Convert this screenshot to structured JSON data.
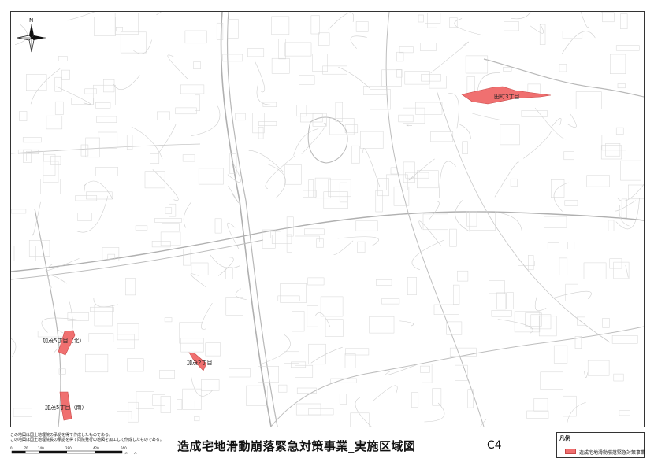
{
  "map": {
    "north_label": "N",
    "area_color": "#f07070",
    "area_stroke": "#c84848",
    "areas": [
      {
        "id": "tsuchiyaku",
        "label": "田町3丁目"
      },
      {
        "id": "kamo5-north",
        "label": "加茂5丁目（北）"
      },
      {
        "id": "kamo2",
        "label": "加茂2丁目"
      },
      {
        "id": "kamo5-south",
        "label": "加茂5丁目（南）"
      }
    ]
  },
  "footer": {
    "note_line1": "この地図は国土地理院の承認を得て作成したものである。",
    "note_line2": "この地図は国土地理院長の承認を得て同院発行の地図を加工して作成したものである。",
    "scale_ticks": [
      "0",
      "70",
      "140",
      "280",
      "420",
      "560"
    ],
    "scale_unit": "メートル",
    "title": "造成宅地滑動崩落緊急対策事業_実施区域図",
    "sheet_id": "C4"
  },
  "legend": {
    "title": "凡例",
    "item_label": "造成宅地滑動崩落緊急対策事業"
  }
}
